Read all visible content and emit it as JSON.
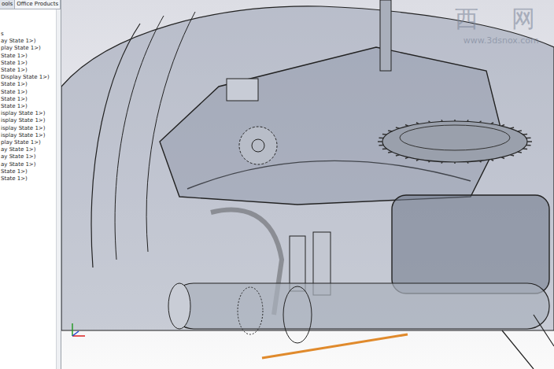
{
  "panel_tabs": [
    {
      "label": "ools",
      "selected": false
    },
    {
      "label": "Office Products",
      "selected": true
    }
  ],
  "tree_items": [
    "s",
    "ay State 1>)",
    "play State 1>)",
    "State 1>)",
    "State 1>)",
    "State 1>)",
    "Display State 1>)",
    "State 1>)",
    "State 1>)",
    "State 1>)",
    "State 1>)",
    "isplay State 1>)",
    "isplay State 1>)",
    "isplay State 1>)",
    "isplay State 1>)",
    "play State 1>)",
    "ay State 1>)",
    "ay State 1>)",
    "ay State 1>)",
    "State 1>)",
    "State 1>)"
  ],
  "watermark": {
    "title": "西 网",
    "url": "www.3dsnox.com"
  }
}
